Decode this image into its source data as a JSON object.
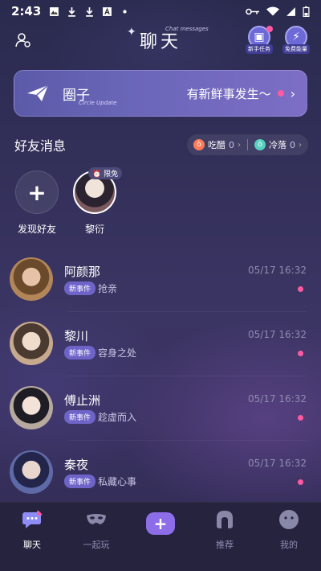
{
  "status_bar": {
    "time": "2:43",
    "left_icons": [
      "image-icon",
      "download-icon",
      "download-icon",
      "text-icon",
      "dot-icon"
    ],
    "right_icons": [
      "vpn-key-icon",
      "wifi-icon",
      "signal-icon",
      "battery-icon"
    ]
  },
  "header": {
    "title": "聊天",
    "title_subtitle": "Chat messages",
    "task_label": "新手任务",
    "energy_label": "免费能量"
  },
  "circle_banner": {
    "title": "圈子",
    "subtitle": "Circle Update",
    "message": "有新鲜事发生～"
  },
  "friends_section": {
    "title": "好友消息",
    "filters": [
      {
        "label": "吃醋",
        "count": "0"
      },
      {
        "label": "冷落",
        "count": "0"
      }
    ],
    "add_label": "发现好友",
    "friend": {
      "name": "黎衍",
      "badge": "限免"
    }
  },
  "chats": [
    {
      "name": "阿颜那",
      "tag": "新事件",
      "preview": "抢亲",
      "time": "05/17 16:32"
    },
    {
      "name": "黎川",
      "tag": "新事件",
      "preview": "容身之处",
      "time": "05/17 16:32"
    },
    {
      "name": "傅止洲",
      "tag": "新事件",
      "preview": "趁虚而入",
      "time": "05/17 16:32"
    },
    {
      "name": "秦夜",
      "tag": "新事件",
      "preview": "私藏心事",
      "time": "05/17 16:32"
    }
  ],
  "tabbar": {
    "tabs": [
      {
        "label": "聊天",
        "icon": "chat-bubble-icon"
      },
      {
        "label": "一起玩",
        "icon": "mask-icon"
      },
      {
        "label": "",
        "icon": "plus-icon"
      },
      {
        "label": "推荐",
        "icon": "arch-icon"
      },
      {
        "label": "我的",
        "icon": "face-icon"
      }
    ]
  },
  "colors": {
    "accent_pink": "#ff5aa0",
    "accent_purple": "#8e6de8",
    "tag_bg": "#6e64c8"
  }
}
